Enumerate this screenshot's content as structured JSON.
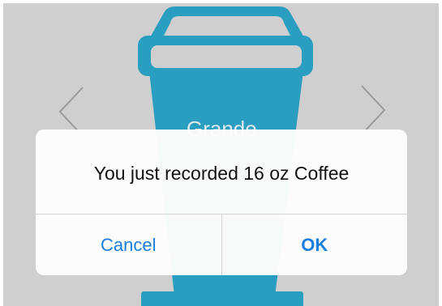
{
  "cup": {
    "size_label": "Grande",
    "icon": "coffee-cup-icon",
    "color": "#2a9ec0"
  },
  "navigation": {
    "prev_icon": "chevron-left-icon",
    "next_icon": "chevron-right-icon"
  },
  "alert": {
    "message": "You just recorded 16 oz Coffee",
    "cancel_label": "Cancel",
    "ok_label": "OK",
    "button_color": "#1a7fe0"
  },
  "background_color": "#cfcfcf"
}
